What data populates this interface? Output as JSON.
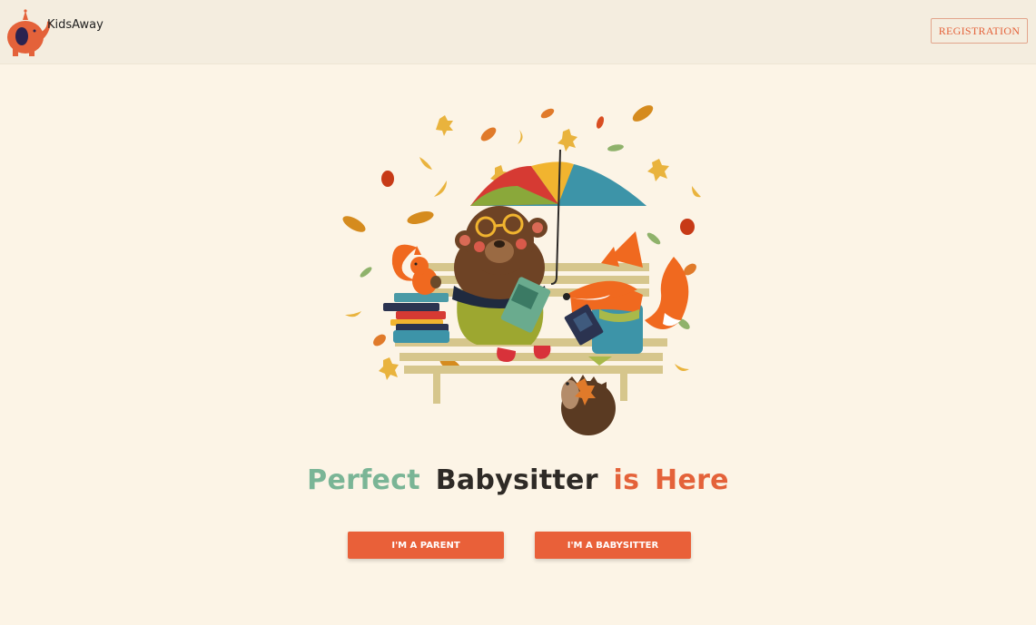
{
  "header": {
    "brand": "KidsAway",
    "registration_label": "REGISTRATION",
    "logo_icon": "elephant-logo-icon"
  },
  "hero": {
    "illustration": "bear-fox-squirrel-hedgehog-bench-umbrella-illustration"
  },
  "headline": {
    "word1": "Perfect",
    "word2": "Babysitter",
    "word3": "is Here"
  },
  "actions": {
    "parent_label": "I'M A PARENT",
    "babysitter_label": "I'M A BABYSITTER"
  },
  "colors": {
    "accent": "#e96039",
    "green": "#7ab596",
    "dark": "#2e2a26",
    "background": "#fcf4e6"
  }
}
